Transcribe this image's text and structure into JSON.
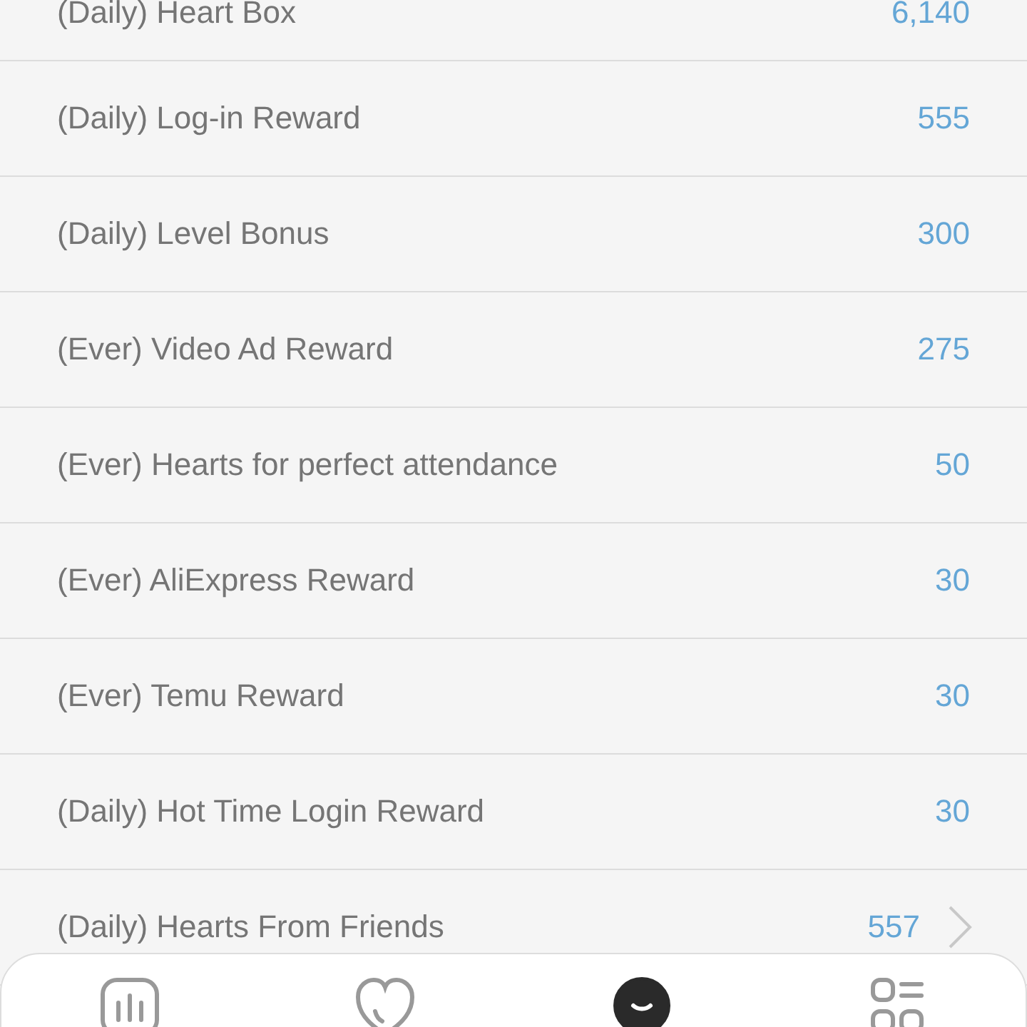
{
  "rewards": [
    {
      "label": "(Daily) Heart Box",
      "value": "6,140",
      "arrow": false
    },
    {
      "label": "(Daily) Log-in Reward",
      "value": "555",
      "arrow": false
    },
    {
      "label": "(Daily) Level Bonus",
      "value": "300",
      "arrow": false
    },
    {
      "label": "(Ever) Video Ad Reward",
      "value": "275",
      "arrow": false
    },
    {
      "label": "(Ever) Hearts for perfect attendance",
      "value": "50",
      "arrow": false
    },
    {
      "label": "(Ever) AliExpress Reward",
      "value": "30",
      "arrow": false
    },
    {
      "label": "(Ever) Temu Reward",
      "value": "30",
      "arrow": false
    },
    {
      "label": "(Daily) Hot Time Login Reward",
      "value": "30",
      "arrow": false
    },
    {
      "label": "(Daily) Hearts From Friends",
      "value": "557",
      "arrow": true
    }
  ],
  "nav": [
    {
      "kind": "stats",
      "selected": false
    },
    {
      "kind": "heart",
      "selected": false
    },
    {
      "kind": "face",
      "selected": true
    },
    {
      "kind": "menu",
      "selected": false
    }
  ]
}
